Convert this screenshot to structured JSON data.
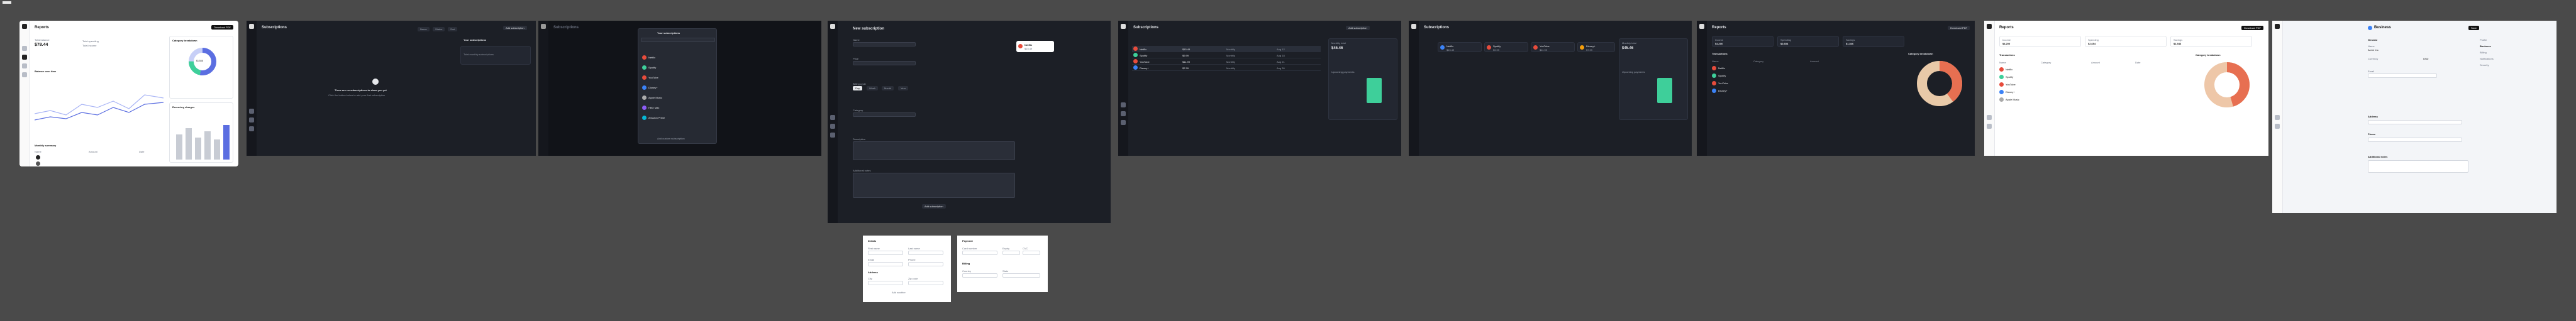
{
  "reports": {
    "title": "Reports",
    "download_label": "Download PDF",
    "metric_label": "Total balance",
    "metric_value": "$78.44",
    "legend": [
      "Total spending",
      "Total income"
    ],
    "chart_title": "Balance over time",
    "categories_title": "Category breakdown",
    "donut_center": "$1,546",
    "monthly_title": "Monthly summary",
    "recurring_title": "Recurring charges",
    "table_headers": [
      "Name",
      "Amount",
      "Date"
    ]
  },
  "subs_empty": {
    "title": "Subscriptions",
    "toolbar": [
      "Name",
      "Status",
      "Sort"
    ],
    "add_label": "Add subscription",
    "empty_title": "There are no subscriptions to show you yet",
    "empty_body": "Click the button below to add your first subscription",
    "panel_title": "Your subscriptions",
    "panel_total": "Total monthly subscriptions"
  },
  "subs_modal": {
    "title": "Subscriptions",
    "modal_title": "Your subscriptions",
    "items": [
      "Netflix",
      "Spotify",
      "YouTube",
      "Disney+",
      "Apple Music",
      "HBO Max",
      "Amazon Prime"
    ],
    "modal_footer": "Add custom subscription"
  },
  "new_sub": {
    "title": "New subscription",
    "name_label": "Name",
    "price_label": "Price",
    "cycle_label": "Billing cycle",
    "cycle_options": [
      "Day",
      "Week",
      "Month",
      "Year"
    ],
    "category_label": "Category",
    "description_label": "Description",
    "notes_label": "Additional notes",
    "submit_label": "Add subscription",
    "toast_title": "Netflix",
    "toast_value": "$15.49"
  },
  "subs_table": {
    "title": "Subscriptions",
    "add_label": "Add subscription",
    "rows": [
      {
        "name": "Netflix",
        "price": "$15.49",
        "cycle": "Monthly",
        "next": "Aug 12"
      },
      {
        "name": "Spotify",
        "price": "$9.99",
        "cycle": "Monthly",
        "next": "Aug 18"
      },
      {
        "name": "YouTube",
        "price": "$11.99",
        "cycle": "Monthly",
        "next": "Aug 21"
      },
      {
        "name": "Disney+",
        "price": "$7.99",
        "cycle": "Monthly",
        "next": "Aug 30"
      }
    ],
    "panel_title": "Monthly total",
    "panel_value": "$45.46",
    "panel_sub": "Upcoming payments"
  },
  "subs_cards": {
    "title": "Subscriptions",
    "cards": [
      {
        "name": "Netflix",
        "price": "$15.49"
      },
      {
        "name": "Spotify",
        "price": "$9.99"
      },
      {
        "name": "YouTube",
        "price": "$11.99"
      },
      {
        "name": "Disney+",
        "price": "$7.99"
      }
    ],
    "panel_title": "Monthly total",
    "panel_value": "$45.46",
    "panel_sub": "Upcoming payments"
  },
  "reports_dark": {
    "title": "Reports",
    "download_label": "Download PDF",
    "stats": [
      {
        "label": "Income",
        "value": "$4,200"
      },
      {
        "label": "Spending",
        "value": "$2,654"
      },
      {
        "label": "Savings",
        "value": "$1,546"
      }
    ],
    "table_title": "Transactions",
    "headers": [
      "Name",
      "Category",
      "Amount"
    ],
    "rows": [
      "Netflix",
      "Spotify",
      "YouTube",
      "Disney+"
    ],
    "donut_title": "Category breakdown"
  },
  "reports_light": {
    "title": "Reports",
    "download_label": "Download PDF",
    "stats": [
      {
        "label": "Income",
        "value": "$4,200"
      },
      {
        "label": "Spending",
        "value": "$2,654"
      },
      {
        "label": "Savings",
        "value": "$1,546"
      }
    ],
    "table_title": "Transactions",
    "headers": [
      "Name",
      "Category",
      "Amount",
      "Date"
    ],
    "rows": [
      "Netflix",
      "Spotify",
      "YouTube",
      "Disney+",
      "Apple Music"
    ],
    "donut_title": "Category breakdown"
  },
  "settings": {
    "title": "Business",
    "save_label": "Save",
    "section_general": "General",
    "name_label": "Name",
    "name_value": "Acme Inc.",
    "currency_label": "Currency",
    "currency_value": "USD",
    "email_label": "Email",
    "address_label": "Address",
    "phone_label": "Phone",
    "notes_label": "Additional notes",
    "menu": [
      "Profile",
      "Business",
      "Billing",
      "Notifications",
      "Security"
    ]
  },
  "form_a": {
    "title": "Details",
    "fields": [
      "First name",
      "Last name",
      "Email",
      "Phone"
    ],
    "section": "Address",
    "fields2": [
      "City",
      "Zip code"
    ],
    "link": "Add another"
  },
  "form_b": {
    "title": "Payment",
    "fields": [
      "Card number",
      "Expiry",
      "CVC"
    ],
    "section": "Billing",
    "fields2": [
      "Country",
      "State"
    ]
  }
}
